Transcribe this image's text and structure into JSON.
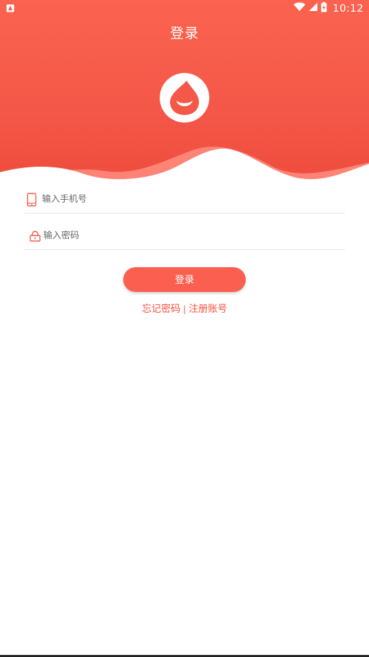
{
  "status_bar": {
    "time": "10:12",
    "icons": [
      "notification-icon",
      "wifi-icon",
      "cell-signal-icon",
      "battery-icon"
    ]
  },
  "header": {
    "title": "登录"
  },
  "form": {
    "phone_placeholder": "输入手机号",
    "password_placeholder": "输入密码",
    "login_label": "登录"
  },
  "links": {
    "forgot_password": "忘记密码",
    "separator": "|",
    "register": "注册账号"
  },
  "colors": {
    "brand": "#f45848",
    "accent_text": "#f4523f",
    "button": "#fb5f4f"
  }
}
